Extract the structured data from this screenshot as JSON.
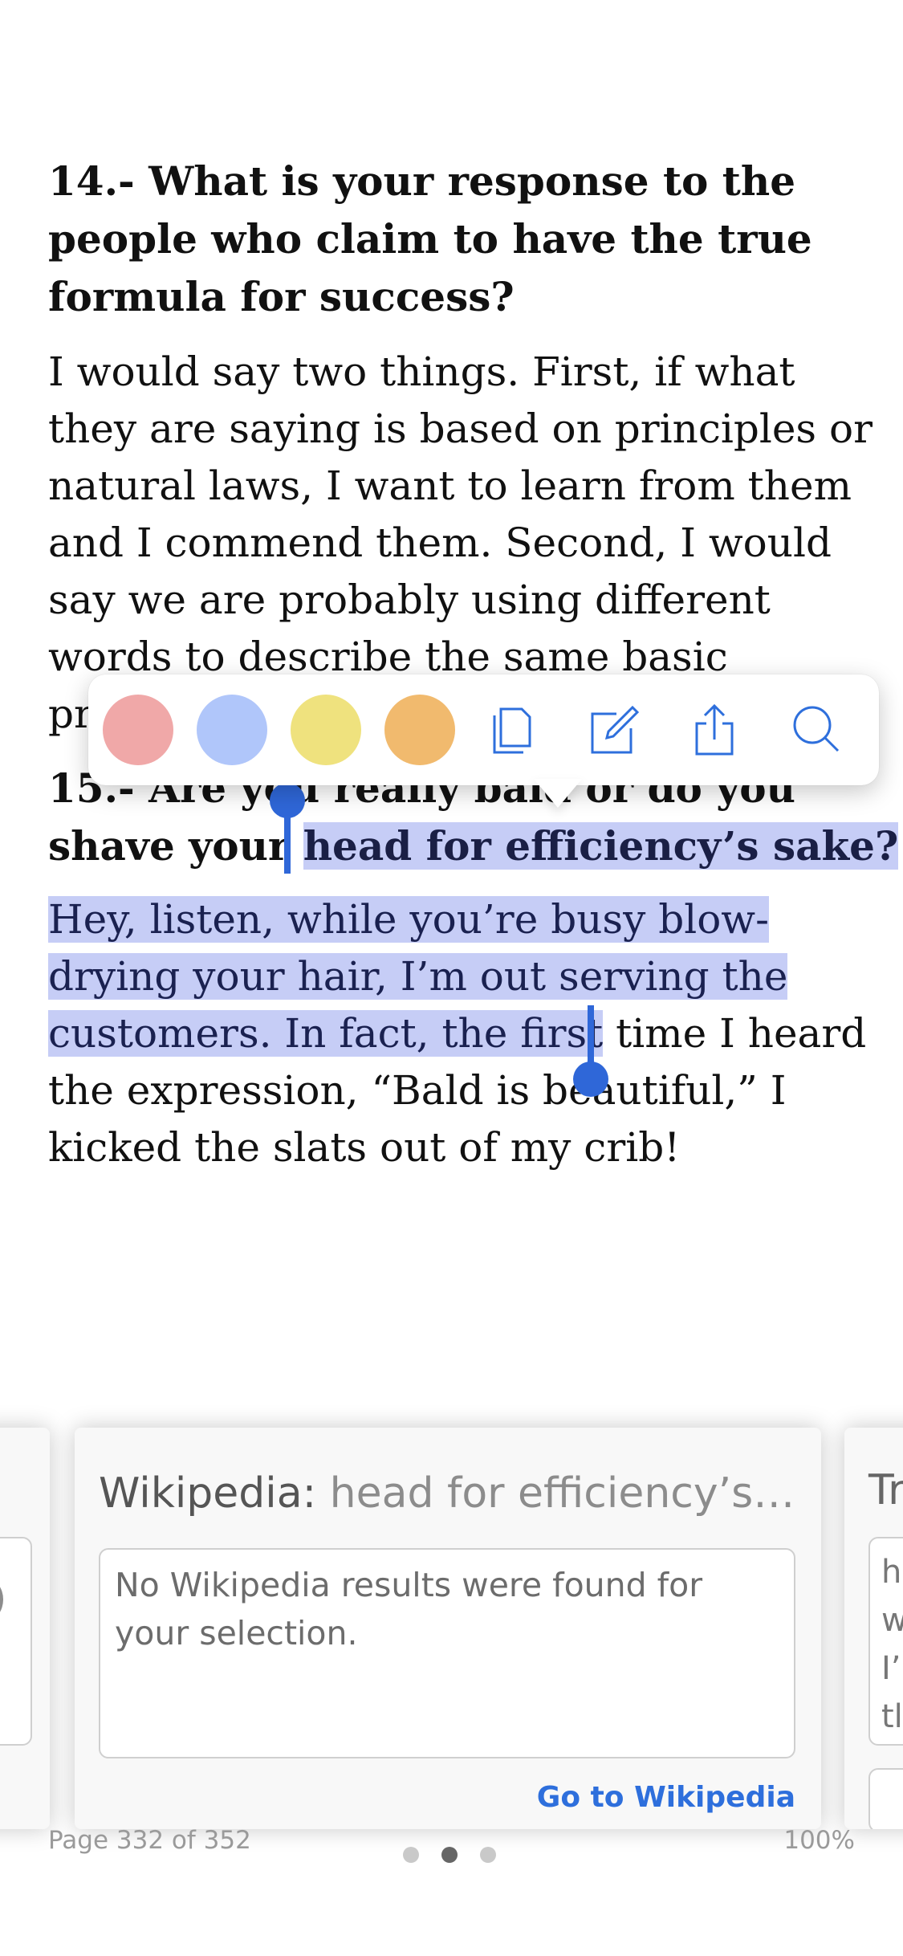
{
  "book": {
    "q14_heading": [
      "14.- What is your response to the",
      "people who claim to have the true",
      "formula for success?"
    ],
    "q14_answer": [
      "I would say two things. First, if what",
      "they are saying is based on principles or",
      "natural laws, I want to learn from them",
      "and I commend them. Second, I would",
      "say we are probably using different",
      "words to describe the same basic",
      "pr"
    ],
    "q15_heading_line1": "15.- Are you really bald or do you",
    "q15_heading_line2_plain": "shave your ",
    "q15_heading_line2_selected": "head for efficiency’s sake?",
    "q15_answer_line1_selected": "Hey, listen, while you’re busy blow-",
    "q15_answer_line2_selected": "drying your hair, I’m out serving the",
    "q15_answer_line3_selected": "customers. In fact, the first",
    "q15_answer_line3_plain": " time I heard",
    "q15_answer_line4": "the expression, “Bald is beautiful,” I",
    "q15_answer_line5": "kicked the slats out of my crib!"
  },
  "toolbar": {
    "swatches": [
      {
        "name": "highlight-red",
        "color": "#f0a8a8"
      },
      {
        "name": "highlight-blue",
        "color": "#b0c6fa"
      },
      {
        "name": "highlight-yellow",
        "color": "#efe27e"
      },
      {
        "name": "highlight-orange",
        "color": "#f1ba6e"
      }
    ],
    "icons": [
      "copy-icon",
      "note-icon",
      "share-icon",
      "search-icon"
    ],
    "icon_color": "#2e6fdc"
  },
  "lookup": {
    "main_card": {
      "source": "Wikipedia:",
      "term": "head for efficiency’s…",
      "message": "No Wikipedia results were found for your selection.",
      "link": "Go to Wikipedia"
    },
    "right_card": {
      "title_fragment": "Tr",
      "line_fragments": [
        "h",
        "w",
        "I’",
        "tl"
      ]
    }
  },
  "footer": {
    "page": "Page 332 of 352",
    "percent": "100%",
    "dots_total": 3,
    "dots_active_index": 1
  }
}
